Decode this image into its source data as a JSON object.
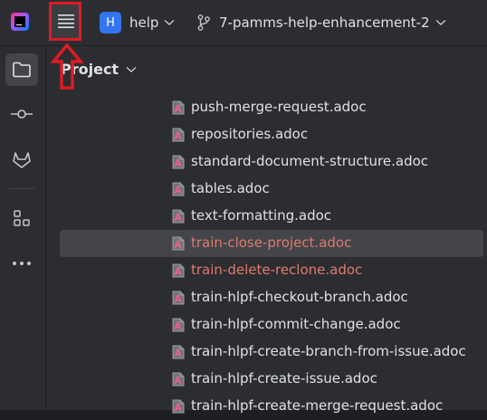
{
  "toolbar": {
    "project_initial": "H",
    "project_name": "help",
    "branch_name": "7-pamms-help-enhancement-2"
  },
  "toolstrip": {
    "items": [
      "folder-icon",
      "commit-icon",
      "gitlab-icon",
      "structure-icon",
      "more-icon"
    ]
  },
  "panel": {
    "title": "Project",
    "files": [
      {
        "name": "push-merge-request.adoc",
        "state": "normal"
      },
      {
        "name": "repositories.adoc",
        "state": "normal"
      },
      {
        "name": "standard-document-structure.adoc",
        "state": "normal"
      },
      {
        "name": "tables.adoc",
        "state": "normal"
      },
      {
        "name": "text-formatting.adoc",
        "state": "normal"
      },
      {
        "name": "train-close-project.adoc",
        "state": "modified",
        "selected": true
      },
      {
        "name": "train-delete-reclone.adoc",
        "state": "modified"
      },
      {
        "name": "train-hlpf-checkout-branch.adoc",
        "state": "normal"
      },
      {
        "name": "train-hlpf-commit-change.adoc",
        "state": "normal"
      },
      {
        "name": "train-hlpf-create-branch-from-issue.adoc",
        "state": "normal"
      },
      {
        "name": "train-hlpf-create-issue.adoc",
        "state": "normal"
      },
      {
        "name": "train-hlpf-create-merge-request.adoc",
        "state": "normal"
      }
    ]
  },
  "colors": {
    "accent": "#3574f0",
    "highlight_annotation": "#e01b24",
    "modified_file": "#e07a6e"
  }
}
